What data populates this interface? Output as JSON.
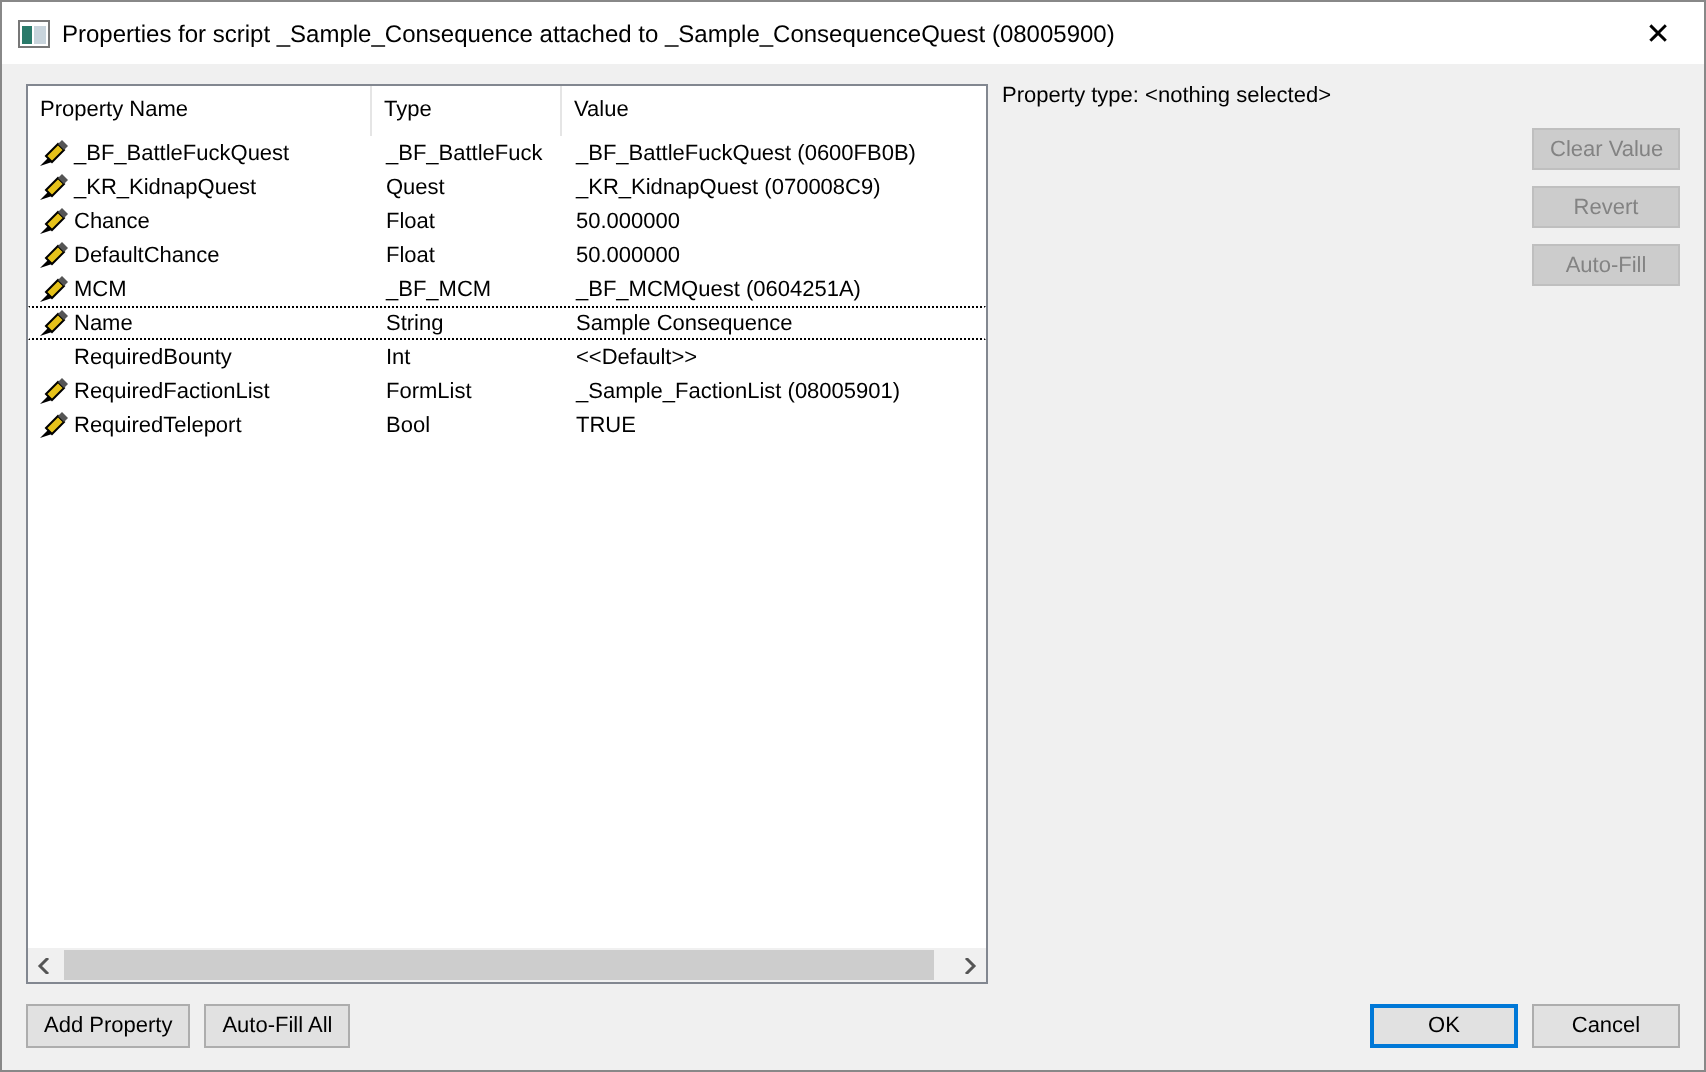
{
  "window": {
    "title": "Properties for script _Sample_Consequence attached to _Sample_ConsequenceQuest (08005900)",
    "close": "✕"
  },
  "table": {
    "columns": [
      "Property Name",
      "Type",
      "Value"
    ],
    "rows": [
      {
        "name": "_BF_BattleFuckQuest",
        "type": "_BF_BattleFuck",
        "value": "_BF_BattleFuckQuest (0600FB0B)",
        "filled": true,
        "focused": false
      },
      {
        "name": "_KR_KidnapQuest",
        "type": "Quest",
        "value": "_KR_KidnapQuest (070008C9)",
        "filled": true,
        "focused": false
      },
      {
        "name": "Chance",
        "type": "Float",
        "value": "50.000000",
        "filled": true,
        "focused": false
      },
      {
        "name": "DefaultChance",
        "type": "Float",
        "value": "50.000000",
        "filled": true,
        "focused": false
      },
      {
        "name": "MCM",
        "type": "_BF_MCM",
        "value": "_BF_MCMQuest (0604251A)",
        "filled": true,
        "focused": false
      },
      {
        "name": "Name",
        "type": "String",
        "value": "Sample Consequence",
        "filled": true,
        "focused": true
      },
      {
        "name": "RequiredBounty",
        "type": "Int",
        "value": "<<Default>>",
        "filled": false,
        "focused": false
      },
      {
        "name": "RequiredFactionList",
        "type": "FormList",
        "value": "_Sample_FactionList (08005901)",
        "filled": true,
        "focused": false
      },
      {
        "name": "RequiredTeleport",
        "type": "Bool",
        "value": "TRUE",
        "filled": true,
        "focused": false
      }
    ]
  },
  "property_type": "Property type: <nothing selected>",
  "side_buttons": [
    {
      "label": "Clear Value",
      "disabled": true
    },
    {
      "label": "Revert",
      "disabled": true
    },
    {
      "label": "Auto-Fill",
      "disabled": true
    }
  ],
  "bottom_left_buttons": [
    {
      "label": "Add Property"
    },
    {
      "label": "Auto-Fill All"
    }
  ],
  "bottom_right_buttons": [
    {
      "label": "OK",
      "default": true
    },
    {
      "label": "Cancel",
      "default": false
    }
  ]
}
